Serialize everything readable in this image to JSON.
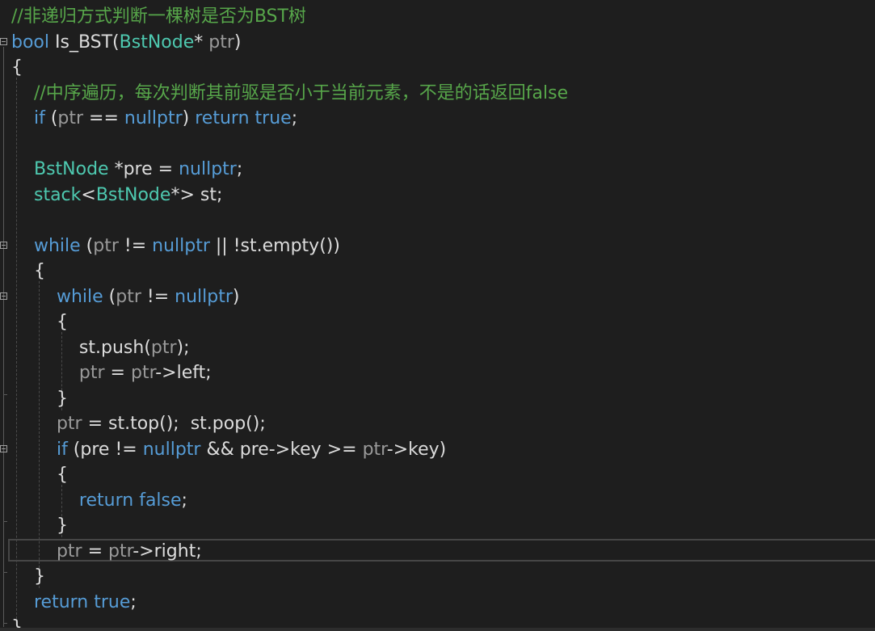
{
  "editor": {
    "theme": "dark",
    "colors": {
      "background": "#1e1e1e",
      "comment": "#57a64a",
      "keyword": "#569cd6",
      "type": "#4ec9b0",
      "parameter": "#9a9a9a",
      "text": "#dcdcdc"
    },
    "lines": [
      [
        {
          "t": "//非递归方式判断一棵树是否为BST树",
          "c": "comment"
        }
      ],
      [
        {
          "t": "bool",
          "c": "kw"
        },
        {
          "t": " Is_BST(",
          "c": "plain"
        },
        {
          "t": "BstNode",
          "c": "type"
        },
        {
          "t": "* ",
          "c": "plain"
        },
        {
          "t": "ptr",
          "c": "param"
        },
        {
          "t": ")",
          "c": "plain"
        }
      ],
      [
        {
          "t": "{",
          "c": "plain"
        }
      ],
      [
        {
          "t": "    ",
          "c": "plain"
        },
        {
          "t": "//中序遍历，每次判断其前驱是否小于当前元素，不是的话返回false",
          "c": "comment"
        }
      ],
      [
        {
          "t": "    ",
          "c": "plain"
        },
        {
          "t": "if",
          "c": "kw"
        },
        {
          "t": " (",
          "c": "plain"
        },
        {
          "t": "ptr",
          "c": "param"
        },
        {
          "t": " == ",
          "c": "plain"
        },
        {
          "t": "nullptr",
          "c": "kw"
        },
        {
          "t": ") ",
          "c": "plain"
        },
        {
          "t": "return",
          "c": "kw"
        },
        {
          "t": " ",
          "c": "plain"
        },
        {
          "t": "true",
          "c": "kw"
        },
        {
          "t": ";",
          "c": "plain"
        }
      ],
      [],
      [
        {
          "t": "    ",
          "c": "plain"
        },
        {
          "t": "BstNode",
          "c": "type"
        },
        {
          "t": " *pre = ",
          "c": "plain"
        },
        {
          "t": "nullptr",
          "c": "kw"
        },
        {
          "t": ";",
          "c": "plain"
        }
      ],
      [
        {
          "t": "    ",
          "c": "plain"
        },
        {
          "t": "stack",
          "c": "type"
        },
        {
          "t": "<",
          "c": "plain"
        },
        {
          "t": "BstNode",
          "c": "type"
        },
        {
          "t": "*> st;",
          "c": "plain"
        }
      ],
      [],
      [
        {
          "t": "    ",
          "c": "plain"
        },
        {
          "t": "while",
          "c": "kw"
        },
        {
          "t": " (",
          "c": "plain"
        },
        {
          "t": "ptr",
          "c": "param"
        },
        {
          "t": " != ",
          "c": "plain"
        },
        {
          "t": "nullptr",
          "c": "kw"
        },
        {
          "t": " || !st.empty())",
          "c": "plain"
        }
      ],
      [
        {
          "t": "    {",
          "c": "plain"
        }
      ],
      [
        {
          "t": "        ",
          "c": "plain"
        },
        {
          "t": "while",
          "c": "kw"
        },
        {
          "t": " (",
          "c": "plain"
        },
        {
          "t": "ptr",
          "c": "param"
        },
        {
          "t": " != ",
          "c": "plain"
        },
        {
          "t": "nullptr",
          "c": "kw"
        },
        {
          "t": ")",
          "c": "plain"
        }
      ],
      [
        {
          "t": "        {",
          "c": "plain"
        }
      ],
      [
        {
          "t": "            st.push(",
          "c": "plain"
        },
        {
          "t": "ptr",
          "c": "param"
        },
        {
          "t": ");",
          "c": "plain"
        }
      ],
      [
        {
          "t": "            ",
          "c": "plain"
        },
        {
          "t": "ptr",
          "c": "param"
        },
        {
          "t": " = ",
          "c": "plain"
        },
        {
          "t": "ptr",
          "c": "param"
        },
        {
          "t": "->left;",
          "c": "plain"
        }
      ],
      [
        {
          "t": "        }",
          "c": "plain"
        }
      ],
      [
        {
          "t": "        ",
          "c": "plain"
        },
        {
          "t": "ptr",
          "c": "param"
        },
        {
          "t": " = st.top();  st.pop();",
          "c": "plain"
        }
      ],
      [
        {
          "t": "        ",
          "c": "plain"
        },
        {
          "t": "if",
          "c": "kw"
        },
        {
          "t": " (pre != ",
          "c": "plain"
        },
        {
          "t": "nullptr",
          "c": "kw"
        },
        {
          "t": " && pre->key >= ",
          "c": "plain"
        },
        {
          "t": "ptr",
          "c": "param"
        },
        {
          "t": "->key)",
          "c": "plain"
        }
      ],
      [
        {
          "t": "        {",
          "c": "plain"
        }
      ],
      [
        {
          "t": "            ",
          "c": "plain"
        },
        {
          "t": "return",
          "c": "kw"
        },
        {
          "t": " ",
          "c": "plain"
        },
        {
          "t": "false",
          "c": "kw"
        },
        {
          "t": ";",
          "c": "plain"
        }
      ],
      [
        {
          "t": "        }",
          "c": "plain"
        }
      ],
      [
        {
          "t": "        ",
          "c": "plain"
        },
        {
          "t": "ptr",
          "c": "param"
        },
        {
          "t": " = ",
          "c": "plain"
        },
        {
          "t": "ptr",
          "c": "param"
        },
        {
          "t": "->right;",
          "c": "plain"
        }
      ],
      [
        {
          "t": "    }",
          "c": "plain"
        }
      ],
      [
        {
          "t": "    ",
          "c": "plain"
        },
        {
          "t": "return",
          "c": "kw"
        },
        {
          "t": " ",
          "c": "plain"
        },
        {
          "t": "true",
          "c": "kw"
        },
        {
          "t": ";",
          "c": "plain"
        }
      ],
      [
        {
          "t": "}",
          "c": "plain"
        }
      ]
    ],
    "fold_markers": [
      {
        "line": 1,
        "icon": "collapse-icon"
      },
      {
        "line": 9,
        "icon": "collapse-icon"
      },
      {
        "line": 11,
        "icon": "collapse-icon"
      },
      {
        "line": 17,
        "icon": "collapse-icon"
      }
    ],
    "current_line": 21
  }
}
